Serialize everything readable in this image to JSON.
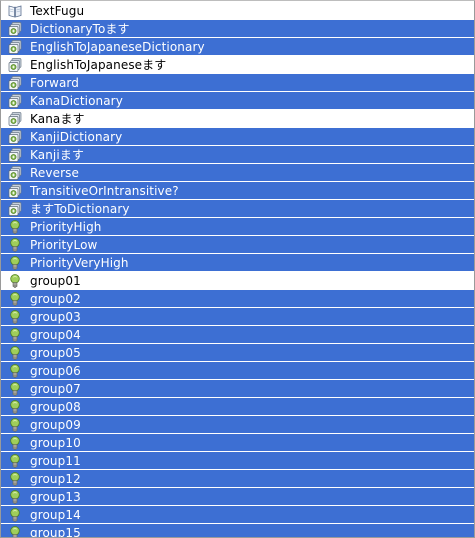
{
  "colors": {
    "selection": "#3d6fd3",
    "selected_text": "#ffffff",
    "normal_text": "#000000"
  },
  "items": [
    {
      "label": "TextFugu",
      "icon": "book-icon",
      "selected": false
    },
    {
      "label": "DictionaryToます",
      "icon": "stack-icon",
      "selected": true
    },
    {
      "label": "EnglishToJapaneseDictionary",
      "icon": "stack-icon",
      "selected": true
    },
    {
      "label": "EnglishToJapaneseます",
      "icon": "stack-icon",
      "selected": false
    },
    {
      "label": "Forward",
      "icon": "stack-icon",
      "selected": true
    },
    {
      "label": "KanaDictionary",
      "icon": "stack-icon",
      "selected": true
    },
    {
      "label": "Kanaます",
      "icon": "stack-icon",
      "selected": false
    },
    {
      "label": "KanjiDictionary",
      "icon": "stack-icon",
      "selected": true
    },
    {
      "label": "Kanjiます",
      "icon": "stack-icon",
      "selected": true
    },
    {
      "label": "Reverse",
      "icon": "stack-icon",
      "selected": true
    },
    {
      "label": "TransitiveOrIntransitive?",
      "icon": "stack-icon",
      "selected": true
    },
    {
      "label": "ますToDictionary",
      "icon": "stack-icon",
      "selected": true
    },
    {
      "label": "PriorityHigh",
      "icon": "bulb-icon",
      "selected": true
    },
    {
      "label": "PriorityLow",
      "icon": "bulb-icon",
      "selected": true
    },
    {
      "label": "PriorityVeryHigh",
      "icon": "bulb-icon",
      "selected": true
    },
    {
      "label": "group01",
      "icon": "bulb-icon",
      "selected": false
    },
    {
      "label": "group02",
      "icon": "bulb-icon",
      "selected": true
    },
    {
      "label": "group03",
      "icon": "bulb-icon",
      "selected": true
    },
    {
      "label": "group04",
      "icon": "bulb-icon",
      "selected": true
    },
    {
      "label": "group05",
      "icon": "bulb-icon",
      "selected": true
    },
    {
      "label": "group06",
      "icon": "bulb-icon",
      "selected": true
    },
    {
      "label": "group07",
      "icon": "bulb-icon",
      "selected": true
    },
    {
      "label": "group08",
      "icon": "bulb-icon",
      "selected": true
    },
    {
      "label": "group09",
      "icon": "bulb-icon",
      "selected": true
    },
    {
      "label": "group10",
      "icon": "bulb-icon",
      "selected": true
    },
    {
      "label": "group11",
      "icon": "bulb-icon",
      "selected": true
    },
    {
      "label": "group12",
      "icon": "bulb-icon",
      "selected": true
    },
    {
      "label": "group13",
      "icon": "bulb-icon",
      "selected": true
    },
    {
      "label": "group14",
      "icon": "bulb-icon",
      "selected": true
    },
    {
      "label": "group15",
      "icon": "bulb-icon",
      "selected": true
    }
  ]
}
